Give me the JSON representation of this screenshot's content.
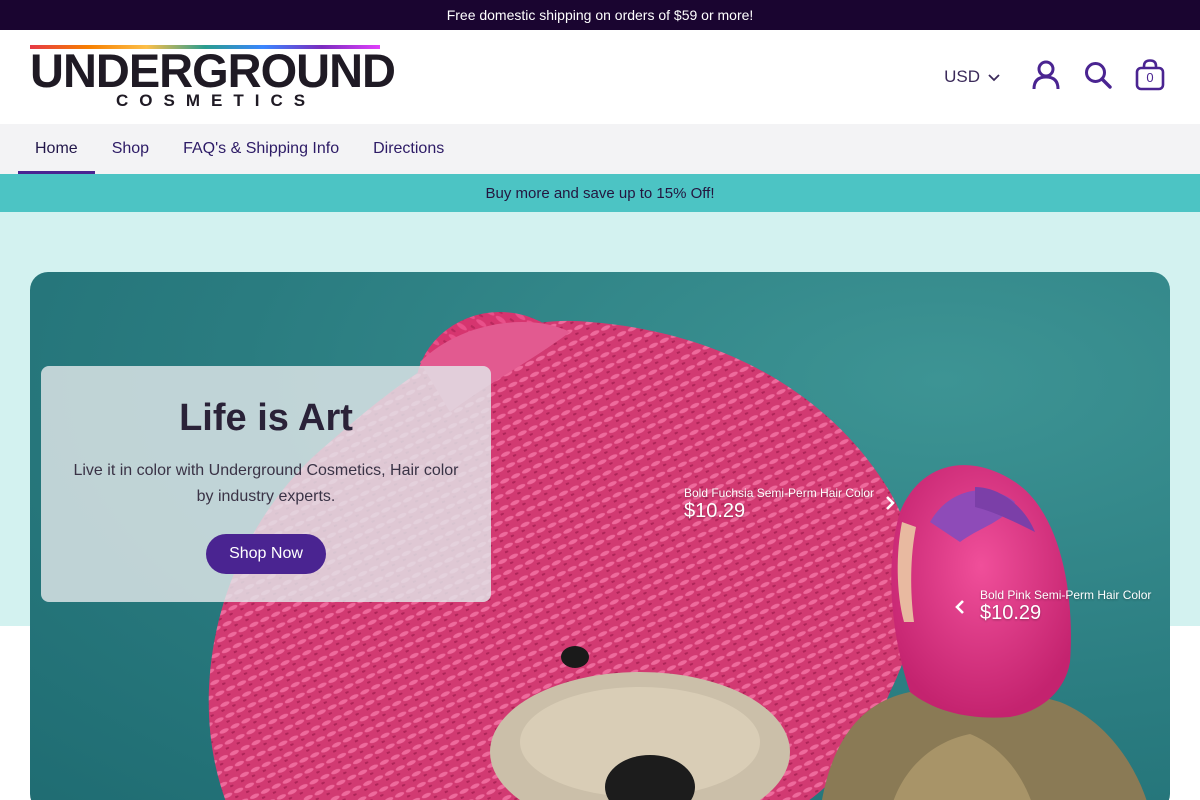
{
  "announcement": "Free domestic shipping on orders of $59 or more!",
  "brand": {
    "name_main": "UNDERGROUND",
    "name_sub": "COSMETICS"
  },
  "header": {
    "currency": "USD",
    "cart_count": "0",
    "icons": [
      "chevron-down-icon",
      "account-icon",
      "search-icon",
      "cart-bag-icon"
    ]
  },
  "nav": {
    "items": [
      {
        "label": "Home",
        "active": true
      },
      {
        "label": "Shop"
      },
      {
        "label": "FAQ's & Shipping Info"
      },
      {
        "label": "Directions"
      }
    ]
  },
  "promo": "Buy more and save up to 15% Off!",
  "hero": {
    "title": "Life is Art",
    "subtitle": "Live it in color with Underground Cosmetics, Hair color by industry experts.",
    "button": "Shop Now",
    "hotspots": [
      {
        "name": "Bold Fuchsia Semi-Perm Hair Color",
        "price": "$10.29",
        "arrow": "chevron-right-icon"
      },
      {
        "name": "Bold Pink Semi-Perm Hair Color",
        "price": "$10.29",
        "arrow": "chevron-left-icon"
      }
    ]
  },
  "colors": {
    "announcement_bg": "#1a0530",
    "accent": "#4a2491",
    "promo_bg": "#4cc4c4",
    "hero_section_bg": "#d3f2f0",
    "hero_teal": "#2a7c80",
    "bear_pink": "#d6356f"
  }
}
